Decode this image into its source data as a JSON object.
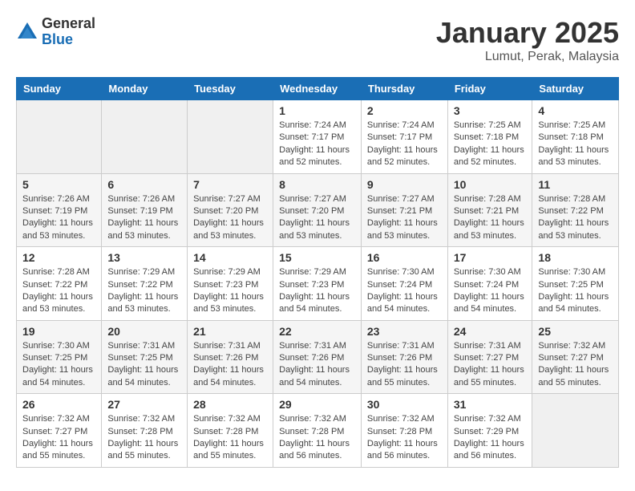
{
  "header": {
    "logo_general": "General",
    "logo_blue": "Blue",
    "month_title": "January 2025",
    "location": "Lumut, Perak, Malaysia"
  },
  "weekdays": [
    "Sunday",
    "Monday",
    "Tuesday",
    "Wednesday",
    "Thursday",
    "Friday",
    "Saturday"
  ],
  "weeks": [
    [
      {
        "day": "",
        "info": ""
      },
      {
        "day": "",
        "info": ""
      },
      {
        "day": "",
        "info": ""
      },
      {
        "day": "1",
        "info": "Sunrise: 7:24 AM\nSunset: 7:17 PM\nDaylight: 11 hours and 52 minutes."
      },
      {
        "day": "2",
        "info": "Sunrise: 7:24 AM\nSunset: 7:17 PM\nDaylight: 11 hours and 52 minutes."
      },
      {
        "day": "3",
        "info": "Sunrise: 7:25 AM\nSunset: 7:18 PM\nDaylight: 11 hours and 52 minutes."
      },
      {
        "day": "4",
        "info": "Sunrise: 7:25 AM\nSunset: 7:18 PM\nDaylight: 11 hours and 53 minutes."
      }
    ],
    [
      {
        "day": "5",
        "info": "Sunrise: 7:26 AM\nSunset: 7:19 PM\nDaylight: 11 hours and 53 minutes."
      },
      {
        "day": "6",
        "info": "Sunrise: 7:26 AM\nSunset: 7:19 PM\nDaylight: 11 hours and 53 minutes."
      },
      {
        "day": "7",
        "info": "Sunrise: 7:27 AM\nSunset: 7:20 PM\nDaylight: 11 hours and 53 minutes."
      },
      {
        "day": "8",
        "info": "Sunrise: 7:27 AM\nSunset: 7:20 PM\nDaylight: 11 hours and 53 minutes."
      },
      {
        "day": "9",
        "info": "Sunrise: 7:27 AM\nSunset: 7:21 PM\nDaylight: 11 hours and 53 minutes."
      },
      {
        "day": "10",
        "info": "Sunrise: 7:28 AM\nSunset: 7:21 PM\nDaylight: 11 hours and 53 minutes."
      },
      {
        "day": "11",
        "info": "Sunrise: 7:28 AM\nSunset: 7:22 PM\nDaylight: 11 hours and 53 minutes."
      }
    ],
    [
      {
        "day": "12",
        "info": "Sunrise: 7:28 AM\nSunset: 7:22 PM\nDaylight: 11 hours and 53 minutes."
      },
      {
        "day": "13",
        "info": "Sunrise: 7:29 AM\nSunset: 7:22 PM\nDaylight: 11 hours and 53 minutes."
      },
      {
        "day": "14",
        "info": "Sunrise: 7:29 AM\nSunset: 7:23 PM\nDaylight: 11 hours and 53 minutes."
      },
      {
        "day": "15",
        "info": "Sunrise: 7:29 AM\nSunset: 7:23 PM\nDaylight: 11 hours and 54 minutes."
      },
      {
        "day": "16",
        "info": "Sunrise: 7:30 AM\nSunset: 7:24 PM\nDaylight: 11 hours and 54 minutes."
      },
      {
        "day": "17",
        "info": "Sunrise: 7:30 AM\nSunset: 7:24 PM\nDaylight: 11 hours and 54 minutes."
      },
      {
        "day": "18",
        "info": "Sunrise: 7:30 AM\nSunset: 7:25 PM\nDaylight: 11 hours and 54 minutes."
      }
    ],
    [
      {
        "day": "19",
        "info": "Sunrise: 7:30 AM\nSunset: 7:25 PM\nDaylight: 11 hours and 54 minutes."
      },
      {
        "day": "20",
        "info": "Sunrise: 7:31 AM\nSunset: 7:25 PM\nDaylight: 11 hours and 54 minutes."
      },
      {
        "day": "21",
        "info": "Sunrise: 7:31 AM\nSunset: 7:26 PM\nDaylight: 11 hours and 54 minutes."
      },
      {
        "day": "22",
        "info": "Sunrise: 7:31 AM\nSunset: 7:26 PM\nDaylight: 11 hours and 54 minutes."
      },
      {
        "day": "23",
        "info": "Sunrise: 7:31 AM\nSunset: 7:26 PM\nDaylight: 11 hours and 55 minutes."
      },
      {
        "day": "24",
        "info": "Sunrise: 7:31 AM\nSunset: 7:27 PM\nDaylight: 11 hours and 55 minutes."
      },
      {
        "day": "25",
        "info": "Sunrise: 7:32 AM\nSunset: 7:27 PM\nDaylight: 11 hours and 55 minutes."
      }
    ],
    [
      {
        "day": "26",
        "info": "Sunrise: 7:32 AM\nSunset: 7:27 PM\nDaylight: 11 hours and 55 minutes."
      },
      {
        "day": "27",
        "info": "Sunrise: 7:32 AM\nSunset: 7:28 PM\nDaylight: 11 hours and 55 minutes."
      },
      {
        "day": "28",
        "info": "Sunrise: 7:32 AM\nSunset: 7:28 PM\nDaylight: 11 hours and 55 minutes."
      },
      {
        "day": "29",
        "info": "Sunrise: 7:32 AM\nSunset: 7:28 PM\nDaylight: 11 hours and 56 minutes."
      },
      {
        "day": "30",
        "info": "Sunrise: 7:32 AM\nSunset: 7:28 PM\nDaylight: 11 hours and 56 minutes."
      },
      {
        "day": "31",
        "info": "Sunrise: 7:32 AM\nSunset: 7:29 PM\nDaylight: 11 hours and 56 minutes."
      },
      {
        "day": "",
        "info": ""
      }
    ]
  ]
}
